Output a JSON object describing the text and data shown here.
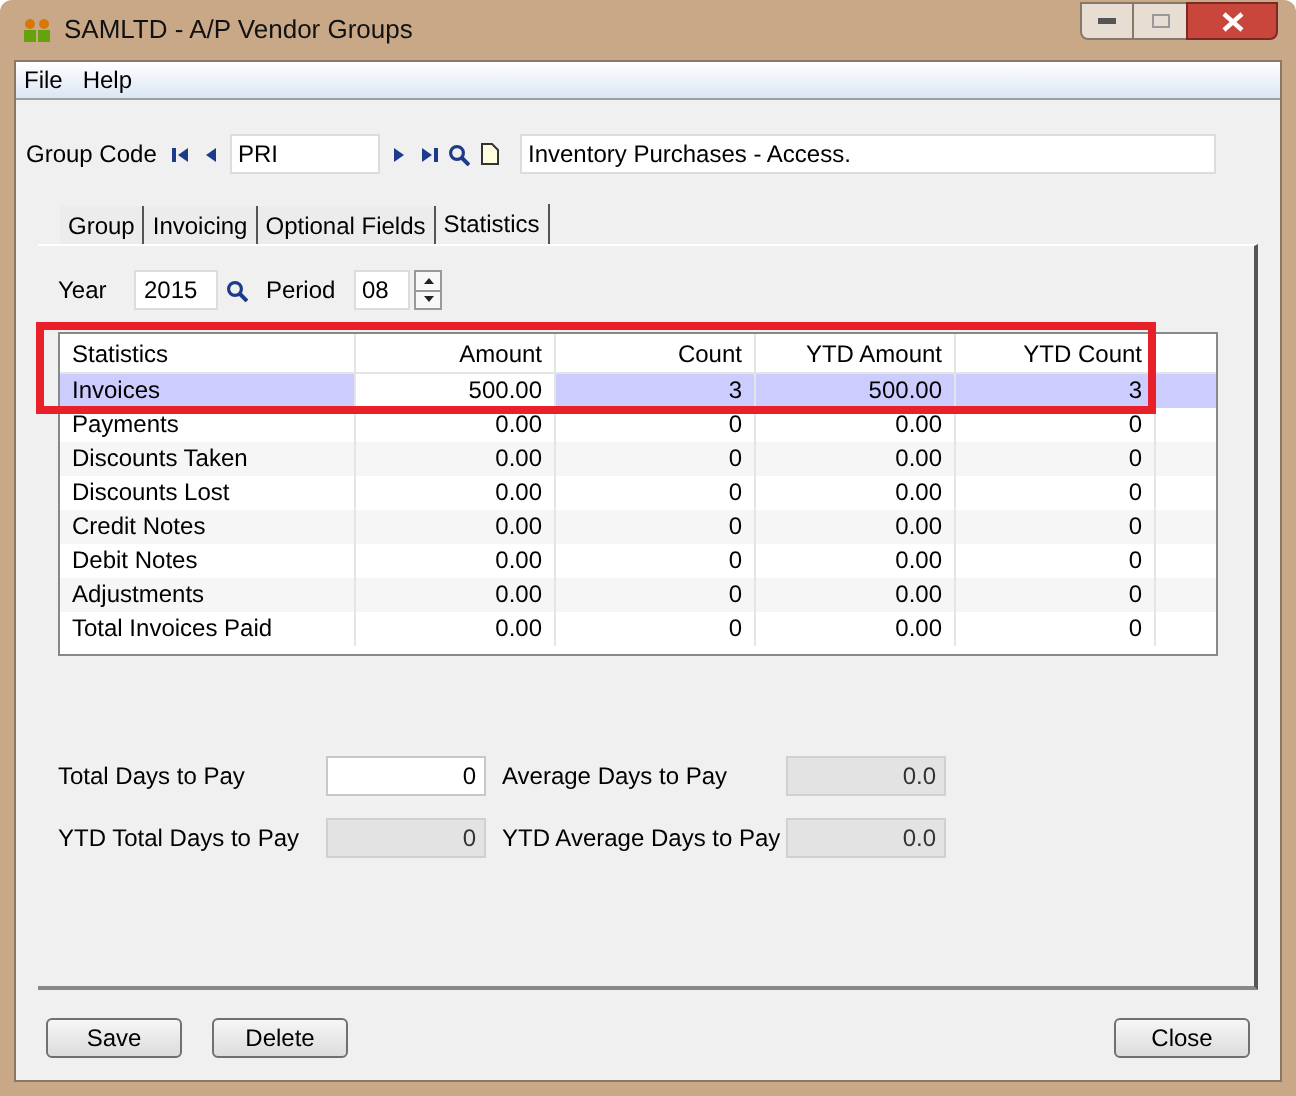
{
  "window": {
    "title": "SAMLTD - A/P Vendor Groups"
  },
  "menu": [
    {
      "label": "File"
    },
    {
      "label": "Help"
    }
  ],
  "group_code": {
    "label": "Group Code",
    "value": "PRI",
    "description": "Inventory Purchases - Access."
  },
  "tabs": [
    {
      "label": "Group",
      "selected": false
    },
    {
      "label": "Invoicing",
      "selected": false
    },
    {
      "label": "Optional Fields",
      "selected": false
    },
    {
      "label": "Statistics",
      "selected": true
    }
  ],
  "year": {
    "label": "Year",
    "value": "2015"
  },
  "period": {
    "label": "Period",
    "value": "08"
  },
  "table": {
    "highlighted": true,
    "columns": [
      "Statistics",
      "Amount",
      "Count",
      "YTD Amount",
      "YTD Count"
    ],
    "rows": [
      {
        "label": "Invoices",
        "amount": "500.00",
        "count": "3",
        "ytd_amount": "500.00",
        "ytd_count": "3",
        "selected": true,
        "amount_editing": true
      },
      {
        "label": "Payments",
        "amount": "0.00",
        "count": "0",
        "ytd_amount": "0.00",
        "ytd_count": "0",
        "selected": false
      },
      {
        "label": "Discounts Taken",
        "amount": "0.00",
        "count": "0",
        "ytd_amount": "0.00",
        "ytd_count": "0",
        "selected": false
      },
      {
        "label": "Discounts Lost",
        "amount": "0.00",
        "count": "0",
        "ytd_amount": "0.00",
        "ytd_count": "0",
        "selected": false
      },
      {
        "label": "Credit Notes",
        "amount": "0.00",
        "count": "0",
        "ytd_amount": "0.00",
        "ytd_count": "0",
        "selected": false
      },
      {
        "label": "Debit Notes",
        "amount": "0.00",
        "count": "0",
        "ytd_amount": "0.00",
        "ytd_count": "0",
        "selected": false
      },
      {
        "label": "Adjustments",
        "amount": "0.00",
        "count": "0",
        "ytd_amount": "0.00",
        "ytd_count": "0",
        "selected": false
      },
      {
        "label": "Total Invoices Paid",
        "amount": "0.00",
        "count": "0",
        "ytd_amount": "0.00",
        "ytd_count": "0",
        "selected": false
      }
    ]
  },
  "days_fields": [
    {
      "label": "Total Days to Pay",
      "value": "0",
      "disabled": false
    },
    {
      "label": "Average Days to Pay",
      "value": "0.0",
      "disabled": true
    },
    {
      "label": "YTD Total Days to Pay",
      "value": "0",
      "disabled": true
    },
    {
      "label": "YTD Average Days to Pay",
      "value": "0.0",
      "disabled": true
    }
  ],
  "buttons": [
    {
      "label": "Save"
    },
    {
      "label": "Delete"
    },
    {
      "label": "Close"
    }
  ]
}
